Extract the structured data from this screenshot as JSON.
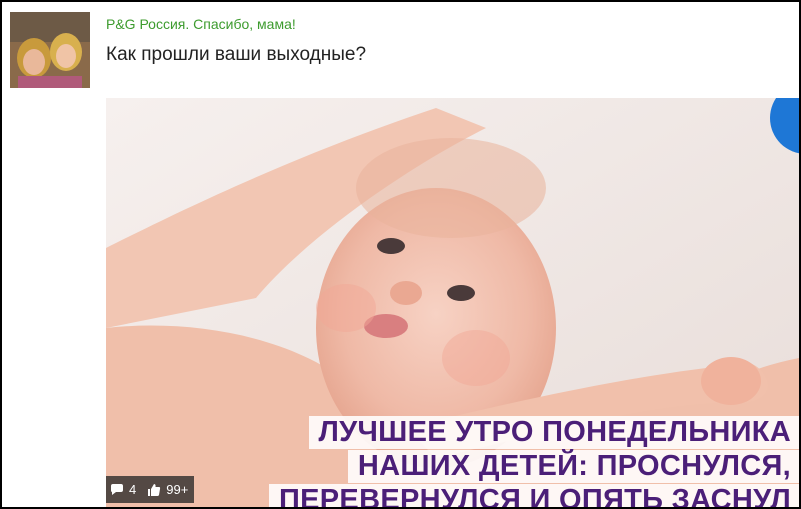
{
  "post": {
    "group_name": "P&G Россия. Спасибо, мама!",
    "text": "Как прошли ваши выходные?"
  },
  "image": {
    "caption_line1": "ЛУЧШЕЕ УТРО ПОНЕДЕЛЬНИКА",
    "caption_line2": "НАШИХ ДЕТЕЙ: ПРОСНУЛСЯ,",
    "caption_line3": "ПЕРЕВЕРНУЛСЯ И ОПЯТЬ ЗАСНУЛ"
  },
  "stats": {
    "comments_icon": "speech-bubble-icon",
    "comments_count": "4",
    "likes_icon": "thumbs-up-icon",
    "likes_count": "99+"
  },
  "colors": {
    "group_name": "#3d9b2e",
    "caption_text": "#4b1f78",
    "badge": "#1e77d6"
  }
}
